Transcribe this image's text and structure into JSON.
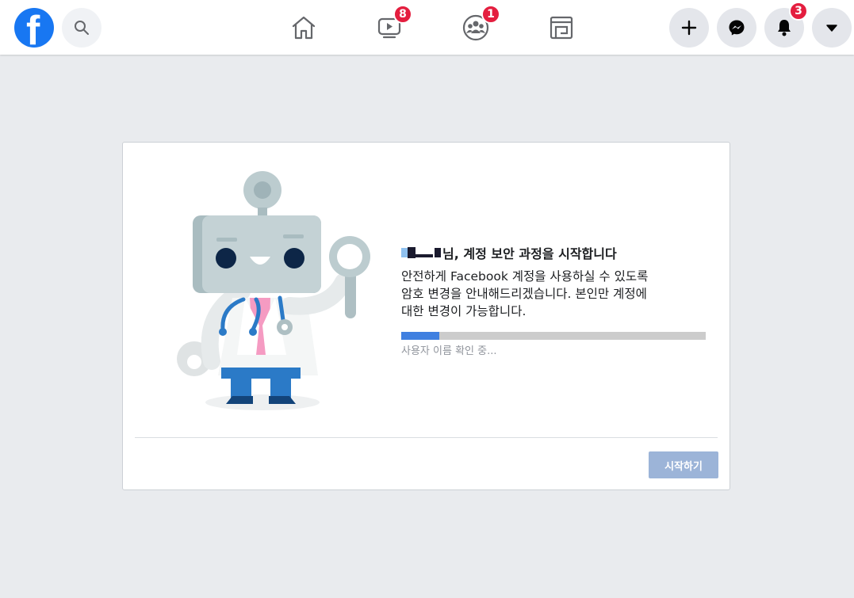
{
  "topbar": {
    "nav": [
      {
        "name": "home-icon"
      },
      {
        "name": "watch-icon",
        "badge": "8"
      },
      {
        "name": "groups-icon",
        "badge": "1"
      },
      {
        "name": "gaming-icon"
      }
    ],
    "notifications_badge": "3"
  },
  "card": {
    "title_suffix": "님, 계정 보안 과정을 시작합니다",
    "body_lines": [
      "안전하게 Facebook 계정을 사용하실 수 있도록",
      "암호 변경을 안내해드리겠습니다. 본인만 계정에",
      "대한 변경이 가능합니다."
    ],
    "progress": 0.125,
    "status": "사용자 이름 확인 중...",
    "start_button": "시작하기"
  },
  "colors": {
    "brand": "#1877f2",
    "badge": "#e41e3f",
    "progress_fill": "#4080e0",
    "button_disabled": "#9cb4d8"
  }
}
